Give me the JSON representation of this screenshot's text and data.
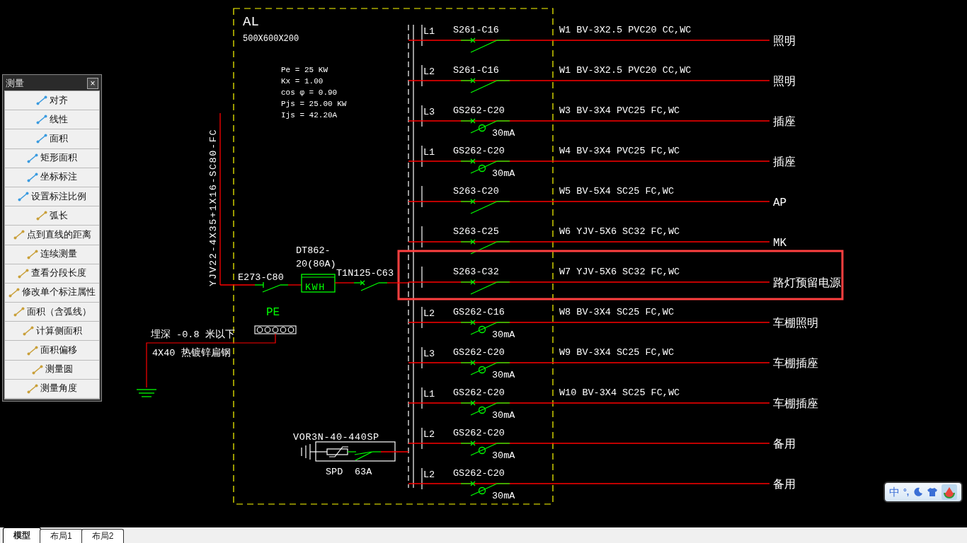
{
  "panel": {
    "name": "AL",
    "size": "500X600X200",
    "params": [
      "Pe = 25 KW",
      "Kx = 1.00",
      "cos φ = 0.90",
      "Pjs = 25.00 KW",
      "Ijs = 42.20A"
    ]
  },
  "incoming": {
    "cable": "YJV22-4X35+1X16-SC80-FC",
    "main_breaker": "E273-C80",
    "meter_model": [
      "DT862-",
      "20(80A)"
    ],
    "meter_label": "KWH",
    "breaker2": "T1N125-C63"
  },
  "earthing": {
    "pe": "PE",
    "depth": "埋深 -0.8 米以下",
    "conductor": "4X40  热镀锌扁钢"
  },
  "spd": {
    "model": "VOR3N-40-440SP",
    "label": "SPD",
    "rating": "63A"
  },
  "circuits": [
    {
      "phase": "L1",
      "breaker": "S261-C16",
      "cable": "W1 BV-3X2.5 PVC20 CC,WC",
      "load": "照明"
    },
    {
      "phase": "L2",
      "breaker": "S261-C16",
      "cable": "W1 BV-3X2.5 PVC20 CC,WC",
      "load": "照明"
    },
    {
      "phase": "L3",
      "breaker": "GS262-C20",
      "rcd": "30mA",
      "cable": "W3 BV-3X4 PVC25 FC,WC",
      "load": "插座"
    },
    {
      "phase": "L1",
      "breaker": "GS262-C20",
      "rcd": "30mA",
      "cable": "W4 BV-3X4 PVC25 FC,WC",
      "load": "插座"
    },
    {
      "breaker": "S263-C20",
      "cable": "W5 BV-5X4 SC25 FC,WC",
      "load": "AP"
    },
    {
      "breaker": "S263-C25",
      "cable": "W6 YJV-5X6 SC32 FC,WC",
      "load": "MK"
    },
    {
      "breaker": "S263-C32",
      "cable": "W7 YJV-5X6 SC32 FC,WC",
      "load": "路灯预留电源",
      "highlighted": true
    },
    {
      "phase": "L2",
      "breaker": "GS262-C16",
      "rcd": "30mA",
      "cable": "W8 BV-3X4 SC25 FC,WC",
      "load": "车棚照明"
    },
    {
      "phase": "L3",
      "breaker": "GS262-C20",
      "rcd": "30mA",
      "cable": "W9 BV-3X4 SC25 FC,WC",
      "load": "车棚插座"
    },
    {
      "phase": "L1",
      "breaker": "GS262-C20",
      "rcd": "30mA",
      "cable": "W10 BV-3X4 SC25 FC,WC",
      "load": "车棚插座"
    },
    {
      "phase": "L2",
      "breaker": "GS262-C20",
      "rcd": "30mA",
      "load": "备用"
    },
    {
      "phase": "L2",
      "breaker": "GS262-C20",
      "rcd": "30mA",
      "load": "备用"
    }
  ],
  "measure_palette": {
    "title": "测量",
    "close": "×",
    "items": [
      {
        "label": "对齐",
        "color": "#3a9be0"
      },
      {
        "label": "线性",
        "color": "#3a9be0"
      },
      {
        "label": "面积",
        "color": "#3a9be0"
      },
      {
        "label": "矩形面积",
        "color": "#3a9be0"
      },
      {
        "label": "坐标标注",
        "color": "#3a9be0"
      },
      {
        "label": "设置标注比例",
        "color": "#3a9be0"
      },
      {
        "label": "弧长",
        "color": "#c9a03a"
      },
      {
        "label": "点到直线的距离",
        "color": "#c9a03a"
      },
      {
        "label": "连续测量",
        "color": "#c9a03a"
      },
      {
        "label": "查看分段长度",
        "color": "#c9a03a"
      },
      {
        "label": "修改单个标注属性",
        "color": "#c9a03a"
      },
      {
        "label": "面积（含弧线）",
        "color": "#c9a03a"
      },
      {
        "label": "计算侧面积",
        "color": "#c9a03a"
      },
      {
        "label": "面积偏移",
        "color": "#c9a03a"
      },
      {
        "label": "测量圆",
        "color": "#c9a03a"
      },
      {
        "label": "测量角度",
        "color": "#c9a03a"
      }
    ]
  },
  "ime": {
    "mode": "中",
    "punctuation": "°,"
  },
  "layout_tabs": [
    {
      "label": "模型",
      "selected": true
    },
    {
      "label": "布局1",
      "selected": false
    },
    {
      "label": "布局2",
      "selected": false
    }
  ]
}
